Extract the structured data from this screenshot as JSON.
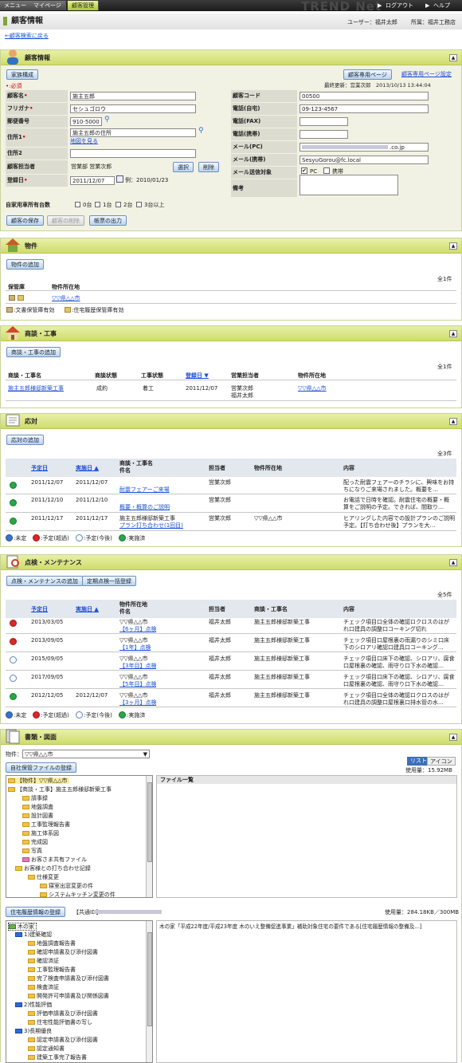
{
  "nav": {
    "tabs": [
      "メニュー",
      "マイページ",
      "顧客管理"
    ],
    "brand": "TREND Net",
    "logout": "ログアウト",
    "help": "ヘルプ"
  },
  "page": {
    "title": "顧客情報",
    "user_label": "ユーザー：福井太郎",
    "org_label": "所属：福井工務店",
    "back_link": "←顧客検索に戻る"
  },
  "customer": {
    "title": "顧客情報",
    "family_button": "家族構成",
    "mypage_button": "顧客専用ページ",
    "mypage_settings_link": "顧客専用ページ設定",
    "required_note": "•:必須",
    "last_updated": "最終更新：営業次郎　2013/10/13 13:44:04",
    "labels": {
      "name": "顧客名",
      "kana": "フリガナ",
      "zip": "郵便番号",
      "address1": "住所1",
      "address2": "住所2",
      "staff": "顧客担当者",
      "registered": "登録日",
      "code": "顧客コード",
      "tel_home": "電話(自宅)",
      "fax": "電話(FAX)",
      "mobile": "電話(携帯)",
      "mail_pc": "メール(PC)",
      "mail_mobile": "メール(携帯)",
      "mail_target": "メール送信対象",
      "note": "備考"
    },
    "values": {
      "name": "施主五郎",
      "kana": "セシュゴロウ",
      "zip": "910-5000",
      "address1": "施主五郎の住所",
      "map_link": "地図を見る",
      "address2": "",
      "staff": "営業部 営業次郎",
      "registered": "2011/12/07",
      "registered_hint": "例：2010/01/23",
      "code": "00500",
      "tel_home": "09-123-4567",
      "fax": "",
      "mobile": "",
      "mail_pc": ".co.jp",
      "mail_mobile": "SesyuGorou@fc.local",
      "target_pc": "PC",
      "target_mobile": "携帯",
      "note": ""
    },
    "select_button": "選択",
    "delete_button": "削除",
    "car_label": "自家用車所有台数",
    "car_options": [
      "0台",
      "1台",
      "2台",
      "3台以上"
    ],
    "save_button": "顧客の保存",
    "remove_button": "顧客の削除",
    "print_button": "帳票の出力"
  },
  "property": {
    "title": "物件",
    "add_button": "物件の追加",
    "count": "全1件",
    "headers": [
      "保管庫",
      "物件所在地"
    ],
    "rows": [
      {
        "location": "▽▽県△△市"
      }
    ],
    "legend": ":文書保管庫有効 ",
    "legend2": ":住宅履歴保管庫有効"
  },
  "deals": {
    "title": "商談・工事",
    "add_button": "商談・工事の追加",
    "count": "全1件",
    "headers": [
      "商談・工事名",
      "商談状態",
      "工事状態",
      "登録日",
      "営業担当者",
      "物件所在地"
    ],
    "rows": [
      {
        "name": "施主五郎様邸新築工事",
        "deal_status": "成約",
        "work_status": "着工",
        "date": "2011/12/07",
        "staff1": "営業次郎",
        "staff2": "福井太郎",
        "location": "▽▽県△△市"
      }
    ]
  },
  "support": {
    "title": "応対",
    "add_button": "応対の追加",
    "count": "全3件",
    "headers": [
      "予定日",
      "実施日",
      "商談・工事名",
      "件名",
      "担当者",
      "物件所在地",
      "内容"
    ],
    "rows": [
      {
        "status": "ok",
        "plan": "2011/12/07",
        "done": "2011/12/07",
        "deal": "",
        "subject": "耐震フェアーご来場",
        "staff": "営業次郎",
        "loc": "",
        "c1": "配った耐震フェアーのチラシに、興味をお持",
        "c2": "ちになりご来場されました。概要を…"
      },
      {
        "status": "ok",
        "plan": "2011/12/10",
        "done": "2011/12/10",
        "deal": "",
        "subject": "概要・概算のご説明",
        "staff": "営業次郎",
        "loc": "",
        "c1": "お電話で日時を確認。耐震住宅の概要・概",
        "c2": "算をご説明の予定。できれば、間取り…"
      },
      {
        "status": "ok",
        "plan": "2011/12/17",
        "done": "2011/12/17",
        "deal": "施主五郎様邸新築工事",
        "subject": "プラン打ち合わせ(1回目)",
        "staff": "営業次郎",
        "loc": "▽▽県△△市",
        "c1": "ヒアリングした内容での設計プランのご説明",
        "c2": "予定。【打ち合わせ後】プランを大…"
      }
    ],
    "legend": [
      ":未定",
      ":予定(超過)",
      ":予定(今後)",
      ":実施済"
    ]
  },
  "maint": {
    "title": "点検・メンテナンス",
    "add_button": "点検・メンテナンスの追加",
    "bulk_button": "定期点検一括登録",
    "count": "全5件",
    "headers": [
      "予定日",
      "実施日",
      "物件所在地",
      "件名",
      "担当者",
      "商談・工事名",
      "内容"
    ],
    "rows": [
      {
        "status": "ng",
        "plan": "2013/03/05",
        "done": "",
        "loc": "▽▽県△△市",
        "subject": "【6ヶ月】点検",
        "staff": "福井太郎",
        "deal": "施主五郎様邸新築工事",
        "c1": "チェック項目口全体の確認ロクロスのはが",
        "c2": "れ口建具の調整口コーキング切れ"
      },
      {
        "status": "ng",
        "plan": "2013/09/05",
        "done": "",
        "loc": "▽▽県△△市",
        "subject": "【1年】点検",
        "staff": "福井太郎",
        "deal": "施主五郎様邸新築工事",
        "c1": "チェック項目口屋根裏の雨漏りのシミ口床",
        "c2": "下のシロアリ確認口建具口コーキング…"
      },
      {
        "status": "wait",
        "plan": "2015/09/05",
        "done": "",
        "loc": "▽▽県△△市",
        "subject": "【3年目】点検",
        "staff": "福井太郎",
        "deal": "施主五郎様邸新築工事",
        "c1": "チェック項目口床下の確認、シロアリ、腐食",
        "c2": "口屋根裏の確認、雨守り口下水の確認…"
      },
      {
        "status": "wait",
        "plan": "2017/09/05",
        "done": "",
        "loc": "▽▽県△△市",
        "subject": "【5年目】点検",
        "staff": "福井太郎",
        "deal": "施主五郎様邸新築工事",
        "c1": "チェック項目口床下の確認、シロアリ、腐食",
        "c2": "口屋根裏の確認、雨守り口下水の確認…"
      },
      {
        "status": "ok",
        "plan": "2012/12/05",
        "done": "2012/12/07",
        "loc": "▽▽県△△市",
        "subject": "【3ヶ月】点検",
        "staff": "福井太郎",
        "deal": "施主五郎様邸新築工事",
        "c1": "チェック項目口全体の確認ロクロスのはが",
        "c2": "れ口建具の調整口屋根裏口排水管の水…"
      }
    ],
    "legend": [
      ":未定",
      ":予定(超過)",
      ":予定(今後)",
      ":実施済"
    ]
  },
  "docs": {
    "title": "書類・図面",
    "property_label": "物件：",
    "property_value": "▽▽県△△市",
    "register_button": "自社保管ファイルの登録",
    "view_list": "リスト",
    "view_icon": "アイコン",
    "usage": "使用量：15.92MB",
    "file_list_header": "ファイル一覧",
    "tree1": [
      "【物件】▽▽県△△市",
      "【商談・工事】施主五郎様邸新築工事",
      "請事録",
      "地盤調査",
      "設計図書",
      "工事監理報告書",
      "施工体系図",
      "完成図",
      "写真",
      "お客さま共有ファイル",
      "お客様との打ち合わせ記録",
      "仕様変更",
      "寝室出窓変更の件",
      "システムキッチン変更の件"
    ],
    "history_button": "住宅履歴情報の登録",
    "common_id_label": "【共通ID】",
    "history_usage": "使用量：284.18KB／300MB",
    "tree2": [
      "木の家",
      "1)建築確認",
      "地盤調査報告書",
      "確認申請書及び添付図書",
      "確認済証",
      "工事監理報告書",
      "完了検査申請書及び添付図書",
      "検査済証",
      "開発許可申請書及び関係図書",
      "2)性能評価",
      "評価申請書及び添付図書",
      "住宅性能評価書の写し",
      "3)長期優良",
      "認定申請書及び添付図書",
      "認定通知書",
      "建築工事完了報告書"
    ],
    "history_desc": "木の家「平成22年度/平成23年度 木のいえ整備促進事業」補助対象住宅の要件である[住宅履歴情報の整備及…]"
  }
}
